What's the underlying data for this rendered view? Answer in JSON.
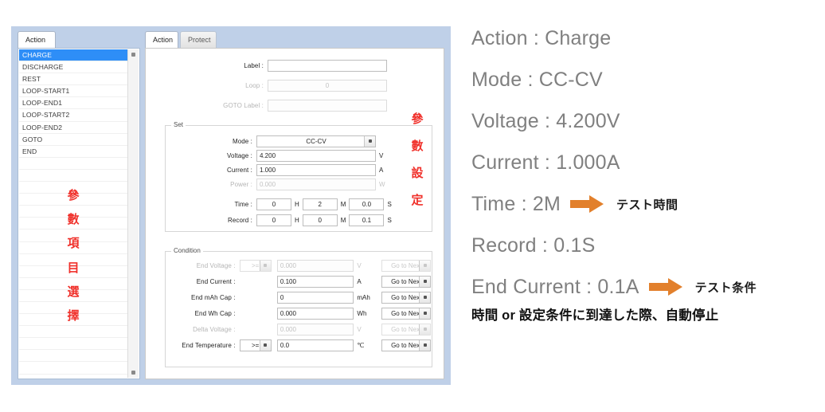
{
  "app_window": {
    "left_panel": {
      "tab_label": "Action",
      "list_items": [
        {
          "label": "CHARGE",
          "selected": true
        },
        {
          "label": "DISCHARGE",
          "selected": false
        },
        {
          "label": "REST",
          "selected": false
        },
        {
          "label": "LOOP-START1",
          "selected": false
        },
        {
          "label": "LOOP-END1",
          "selected": false
        },
        {
          "label": "LOOP-START2",
          "selected": false
        },
        {
          "label": "LOOP-END2",
          "selected": false
        },
        {
          "label": "GOTO",
          "selected": false
        },
        {
          "label": "END",
          "selected": false
        }
      ],
      "annotation_vertical": [
        "參",
        "數",
        "項",
        "目",
        "選",
        "擇"
      ],
      "scrollbar": {
        "up": "scroll-up",
        "down": "scroll-down"
      }
    },
    "right_panel": {
      "tabs": [
        {
          "label": "Action",
          "active": true
        },
        {
          "label": "Protect",
          "active": false
        }
      ],
      "top_fields": [
        {
          "label": "Label :",
          "value": "",
          "disabled": false
        },
        {
          "label": "Loop :",
          "value": "0",
          "disabled": true
        },
        {
          "label": "GOTO Label :",
          "value": "",
          "disabled": true
        }
      ],
      "set_group": {
        "title": "Set",
        "mode": {
          "label": "Mode :",
          "value": "CC-CV"
        },
        "voltage": {
          "label": "Voltage :",
          "value": "4.200",
          "unit": "V"
        },
        "current": {
          "label": "Current :",
          "value": "1.000",
          "unit": "A"
        },
        "power": {
          "label": "Power :",
          "value": "0.000",
          "unit": "W",
          "disabled": true
        },
        "time": {
          "label": "Time :",
          "h": "0",
          "h_unit": "H",
          "m": "2",
          "m_unit": "M",
          "s": "0.0",
          "s_unit": "S"
        },
        "record": {
          "label": "Record :",
          "h": "0",
          "h_unit": "H",
          "m": "0",
          "m_unit": "M",
          "s": "0.1",
          "s_unit": "S"
        }
      },
      "condition_group": {
        "title": "Condition",
        "rows": [
          {
            "label": "End Voltage :",
            "op": ">=",
            "has_op": true,
            "value": "0.000",
            "unit": "V",
            "action": "Go to Next",
            "disabled": true
          },
          {
            "label": "End Current :",
            "op": "",
            "has_op": false,
            "value": "0.100",
            "unit": "A",
            "action": "Go to Next",
            "disabled": false
          },
          {
            "label": "End mAh Cap :",
            "op": "",
            "has_op": false,
            "value": "0",
            "unit": "mAh",
            "action": "Go to Next",
            "disabled": false
          },
          {
            "label": "End Wh Cap :",
            "op": "",
            "has_op": false,
            "value": "0.000",
            "unit": "Wh",
            "action": "Go to Next",
            "disabled": false
          },
          {
            "label": "Delta Voltage :",
            "op": "",
            "has_op": false,
            "value": "0.000",
            "unit": "V",
            "action": "Go to Next",
            "disabled": true
          },
          {
            "label": "End Temperature :",
            "op": ">=",
            "has_op": true,
            "value": "0.0",
            "unit": "℃",
            "action": "Go to Next",
            "disabled": false
          }
        ]
      },
      "annotation_vertical": [
        "參",
        "數",
        "設",
        "定"
      ]
    }
  },
  "notes": {
    "lines": [
      {
        "text": "Action : Charge",
        "arrow": false,
        "jp": ""
      },
      {
        "text": "Mode : CC-CV",
        "arrow": false,
        "jp": ""
      },
      {
        "text": "Voltage : 4.200V",
        "arrow": false,
        "jp": ""
      },
      {
        "text": "Current : 1.000A",
        "arrow": false,
        "jp": ""
      },
      {
        "text": "Time : 2M",
        "arrow": true,
        "jp": "テスト時間"
      },
      {
        "text": "Record  :  0.1S",
        "arrow": false,
        "jp": ""
      },
      {
        "text": "End Current : 0.1A",
        "arrow": true,
        "jp": "テスト条件"
      }
    ],
    "footer": "時間 or 設定条件に到達した際、自動停止"
  },
  "colors": {
    "window_backdrop": "#bfd0e8",
    "selection_blue": "#2e8ef7",
    "annotation_red": "#f0302a",
    "arrow_orange": "#e2802c",
    "note_gray": "#808080"
  }
}
